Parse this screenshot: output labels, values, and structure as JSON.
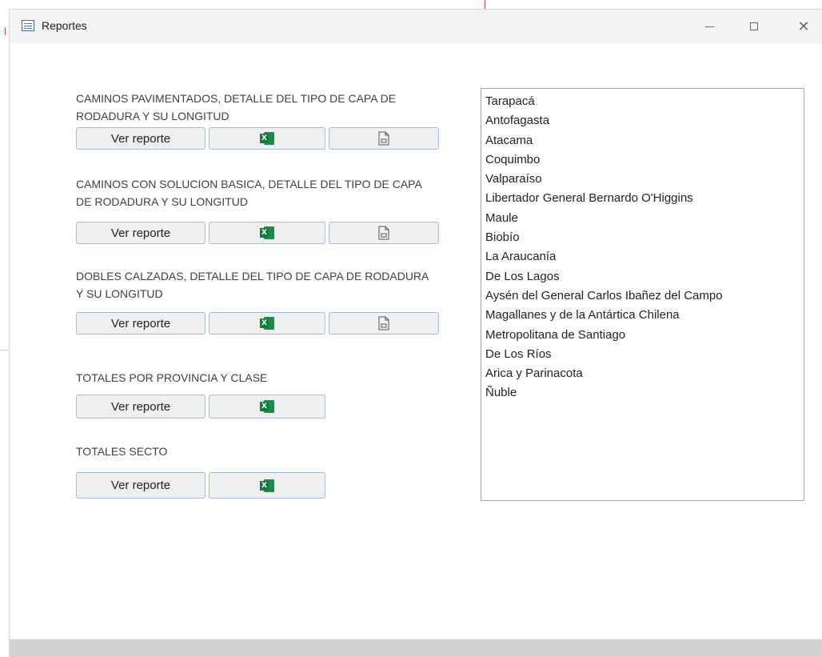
{
  "window": {
    "title": "Reportes"
  },
  "sections": [
    {
      "title": "CAMINOS PAVIMENTADOS, DETALLE DEL TIPO DE CAPA DE RODADURA Y SU LONGITUD",
      "view_label": "Ver reporte",
      "has_export": true
    },
    {
      "title": "CAMINOS CON SOLUCION BASICA, DETALLE DEL TIPO DE CAPA DE RODADURA Y SU LONGITUD",
      "view_label": "Ver reporte",
      "has_export": true
    },
    {
      "title": "DOBLES CALZADAS, DETALLE DEL TIPO DE CAPA DE RODADURA Y SU LONGITUD",
      "view_label": "Ver reporte",
      "has_export": true
    },
    {
      "title": "TOTALES POR PROVINCIA Y CLASE",
      "view_label": "Ver reporte",
      "has_export": false
    },
    {
      "title": "TOTALES SECTO",
      "view_label": "Ver reporte",
      "has_export": false
    }
  ],
  "regions": [
    "Tarapacá",
    "Antofagasta",
    "Atacama",
    "Coquimbo",
    "Valparaíso",
    "Libertador General Bernardo O'Higgins",
    "Maule",
    "Biobío",
    "La Araucanía",
    "De Los Lagos",
    "Aysén del General Carlos Ibañez del Campo",
    "Magallanes y de la Antártica Chilena",
    "Metropolitana de Santiago",
    "De Los Ríos",
    "Arica y Parinacota",
    "Ñuble"
  ],
  "icons": {
    "app": "form-icon",
    "excel": "excel-icon",
    "export": "document-export-icon"
  },
  "colors": {
    "button_border": "#a8b9d6",
    "excel_green": "#107c41",
    "titlebar": "#f5f5f5"
  }
}
